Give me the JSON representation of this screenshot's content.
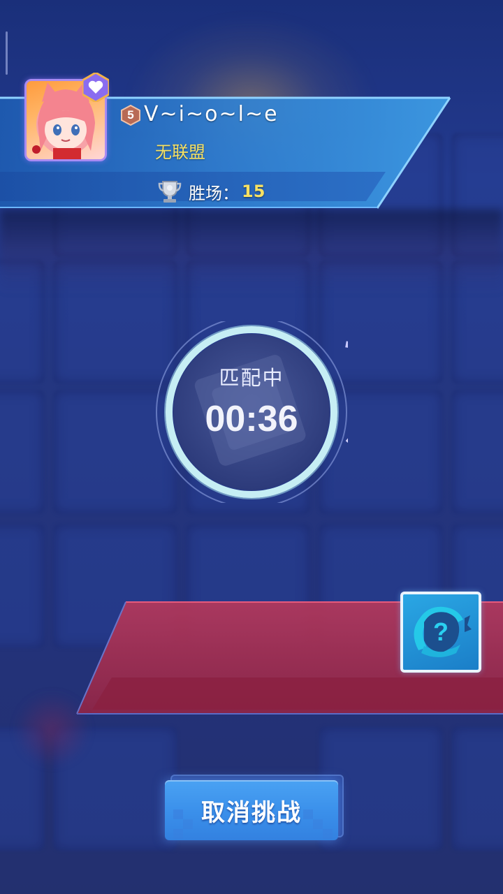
{
  "player": {
    "level": "5",
    "name": "V~i~o~l~e",
    "alliance": "无联盟",
    "wins_label": "胜场：",
    "wins_value": "15"
  },
  "matching": {
    "status": "匹配中",
    "elapsed": "00:36"
  },
  "opponent": {
    "placeholder_icon": "question-mark-icon"
  },
  "actions": {
    "cancel_label": "取消挑战"
  },
  "colors": {
    "background": "#233a8e",
    "banner_blue": "#2f7fd0",
    "alliance_yellow": "#f6e163",
    "opponent_red": "#a3304f",
    "button_blue": "#3a8fea",
    "timer_ring": "#bfe9f3"
  }
}
